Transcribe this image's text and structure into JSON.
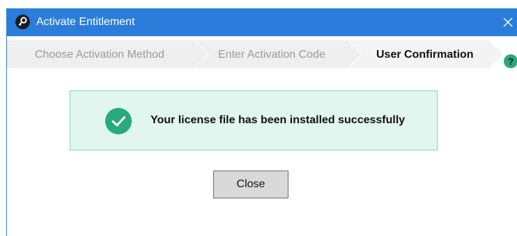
{
  "window": {
    "title": "Activate Entitlement",
    "title_icon": "key-icon",
    "close_icon": "close-icon",
    "accent_color": "#2b7ddb"
  },
  "steps": [
    {
      "label": "Choose Activation Method",
      "state": "completed"
    },
    {
      "label": "Enter Activation Code",
      "state": "completed"
    },
    {
      "label": "User Confirmation",
      "state": "current"
    }
  ],
  "help_icon": "help-icon",
  "message": {
    "icon": "check-circle-icon",
    "text": "Your license file has been installed successfully",
    "background_color": "#e0f6ee",
    "icon_color": "#2aa87e"
  },
  "close_button_label": "Close"
}
